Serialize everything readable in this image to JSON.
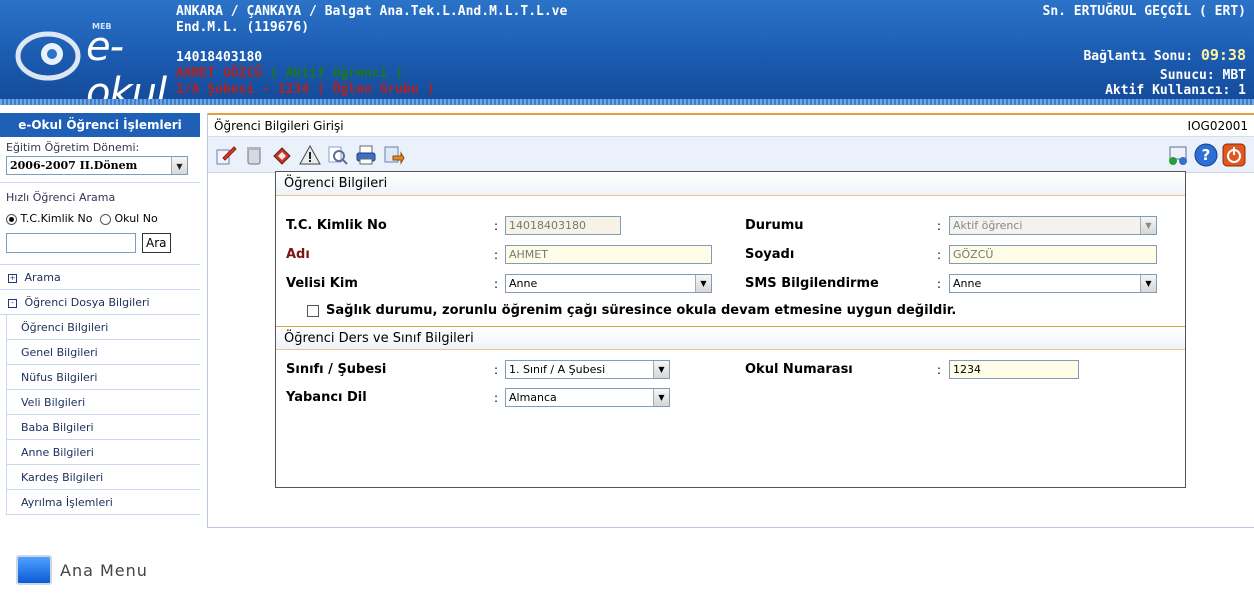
{
  "header": {
    "brand": "e-okul",
    "brand_tag": "MEB",
    "school_line1": "ANKARA / ÇANKAYA / Balgat Ana.Tek.L.And.M.L.T.L.ve",
    "school_line2": "End.M.L. (119676)",
    "tc_no": "14018403180",
    "student_name": "AHMET  GÖZCÜ",
    "student_status": "( Aktif öğrenci )",
    "class_line": "1/A Şubesi - 1234  ( Öğlen Grubu )",
    "user": "Sn. ERTUĞRUL GEÇGİL ( ERT)",
    "session_end_label": "Bağlantı Sonu:",
    "session_end_time": "09:38",
    "server": "Sunucu: MBT",
    "active_users": "Aktif Kullanıcı: 1"
  },
  "sidebar": {
    "title": "e-Okul Öğrenci İşlemleri",
    "period_label": "Eğitim Öğretim Dönemi:",
    "period_value": "2006-2007 II.Dönem",
    "quick_search_label": "Hızlı Öğrenci Arama",
    "radio_tc": "T.C.Kimlik No",
    "radio_okul": "Okul No",
    "search_button": "Ara",
    "search_value": "",
    "groups": [
      {
        "label": "Arama",
        "icon": "+"
      },
      {
        "label": "Öğrenci Dosya Bilgileri",
        "icon": "-"
      }
    ],
    "items": [
      "Öğrenci Bilgileri",
      "Genel Bilgileri",
      "Nüfus Bilgileri",
      "Veli Bilgileri",
      "Baba Bilgileri",
      "Anne Bilgileri",
      "Kardeş Bilgileri",
      "Ayrılma İşlemleri"
    ],
    "main_menu": "Ana Menu"
  },
  "main": {
    "title": "Öğrenci Bilgileri Girişi",
    "page_code": "IOG02001",
    "toolbar_icons": [
      "edit-icon",
      "delete-icon",
      "eraser-icon",
      "warning-icon",
      "search-icon",
      "print-icon",
      "export-icon"
    ],
    "toolbar_right_icons": [
      "network-icon",
      "help-icon",
      "exit-icon"
    ],
    "section1": "Öğrenci Bilgileri",
    "section2": "Öğrenci Ders ve Sınıf Bilgileri",
    "fields": {
      "tc_label": "T.C. Kimlik No",
      "tc_value": "14018403180",
      "durum_label": "Durumu",
      "durum_value": "Aktif öğrenci",
      "adi_label": "Adı",
      "adi_value": "AHMET",
      "soyadi_label": "Soyadı",
      "soyadi_value": "GÖZCÜ",
      "veli_label": "Velisi Kim",
      "veli_value": "Anne",
      "sms_label": "SMS Bilgilendirme",
      "sms_value": "Anne",
      "saglik_text": "Sağlık durumu, zorunlu öğrenim çağı süresince okula devam etmesine uygun değildir.",
      "sinif_label": "Sınıfı / Şubesi",
      "sinif_value": "1. Sınıf / A Şubesi",
      "okulno_label": "Okul Numarası",
      "okulno_value": "1234",
      "dil_label": "Yabancı Dil",
      "dil_value": "Almanca"
    },
    "colon": ":"
  }
}
